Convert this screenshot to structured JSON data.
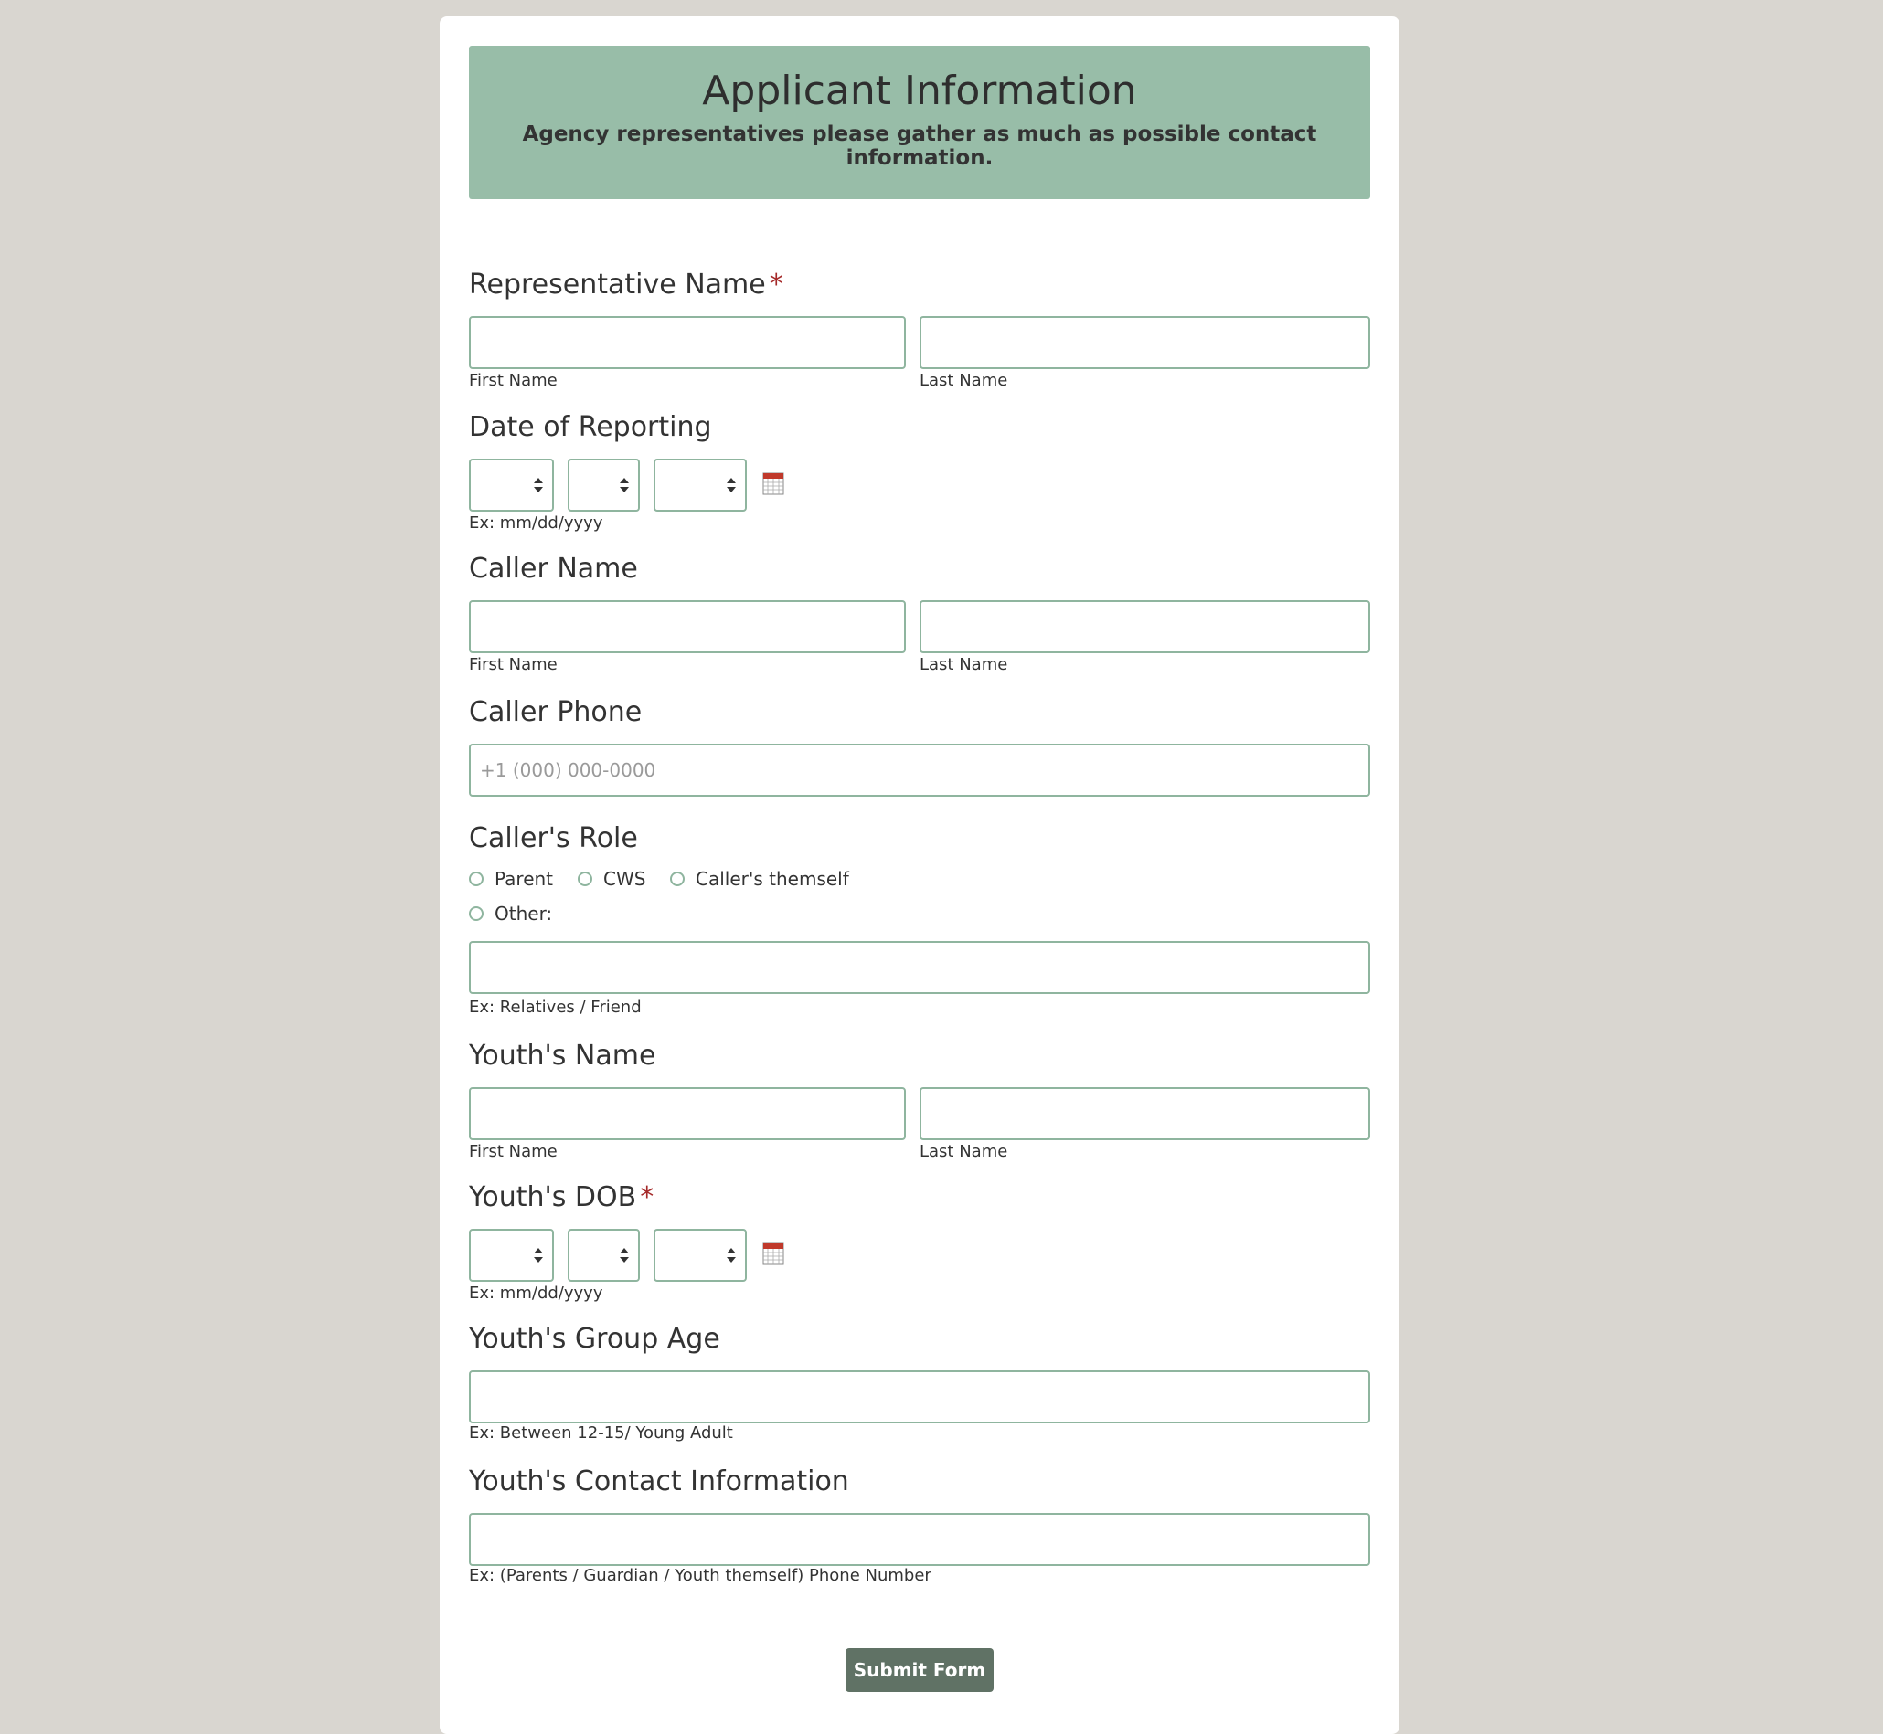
{
  "header": {
    "title": "Applicant Information",
    "subtitle": "Agency representatives please gather as much as possible contact information."
  },
  "representative_name": {
    "label": "Representative Name",
    "required_mark": "*",
    "first_sublabel": "First Name",
    "last_sublabel": "Last Name"
  },
  "date_of_reporting": {
    "label": "Date of Reporting",
    "hint": "Ex: mm/dd/yyyy",
    "icon": "calendar-icon"
  },
  "caller_name": {
    "label": "Caller Name",
    "first_sublabel": "First Name",
    "last_sublabel": "Last Name"
  },
  "caller_phone": {
    "label": "Caller Phone",
    "placeholder": "+1 (000) 000-0000"
  },
  "callers_role": {
    "label": "Caller's Role",
    "options": [
      "Parent",
      "CWS",
      "Caller's themself",
      "Other:"
    ],
    "other_hint": "Ex: Relatives / Friend"
  },
  "youths_name": {
    "label": "Youth's Name",
    "first_sublabel": "First Name",
    "last_sublabel": "Last Name"
  },
  "youths_dob": {
    "label": "Youth's DOB",
    "required_mark": "*",
    "hint": "Ex: mm/dd/yyyy",
    "icon": "calendar-icon"
  },
  "youths_group_age": {
    "label": "Youth's Group Age",
    "hint": "Ex: Between 12-15/ Young Adult"
  },
  "youths_contact": {
    "label": "Youth's Contact Information",
    "hint": "Ex: (Parents / Guardian / Youth themself) Phone Number"
  },
  "submit_label": "Submit Form",
  "colors": {
    "background": "#d9d6d0",
    "header_bg": "#98bda8",
    "input_border": "#8fb59f",
    "required": "#a52a2a",
    "submit_bg": "#607265"
  }
}
